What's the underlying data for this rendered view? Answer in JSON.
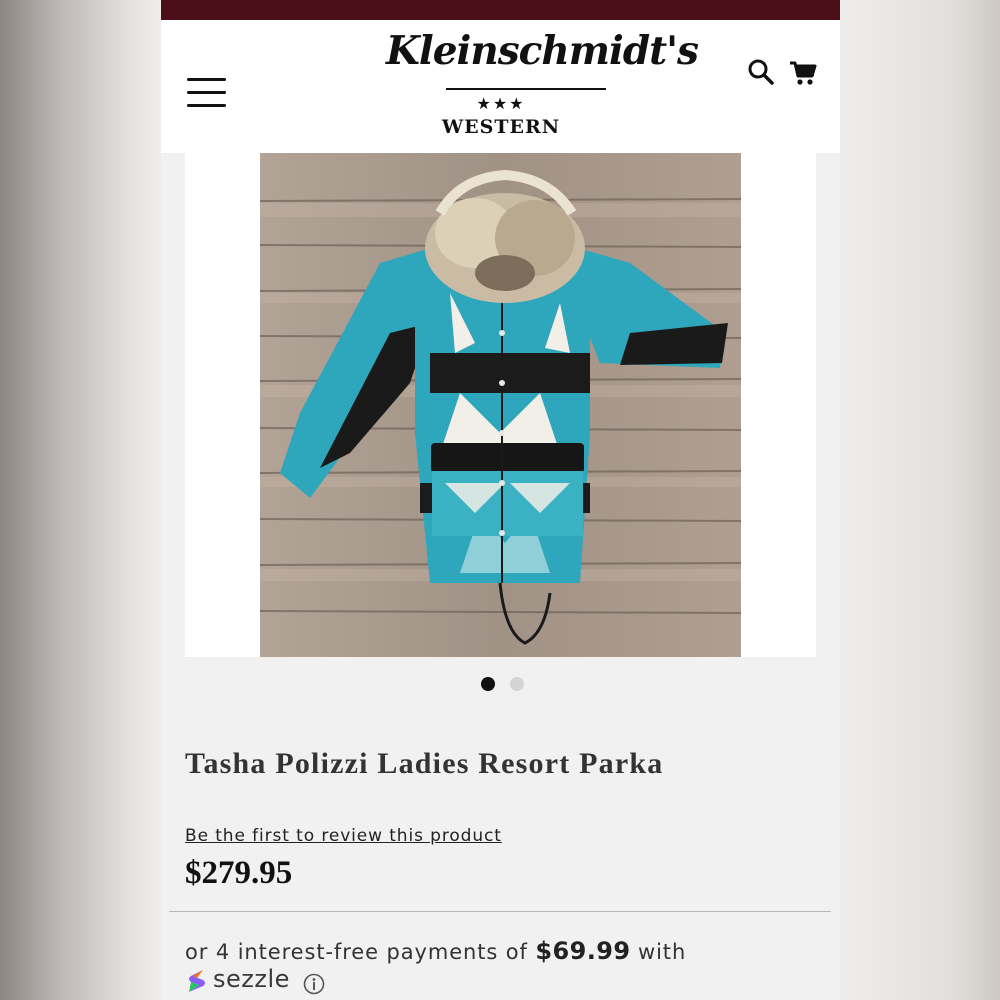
{
  "colors": {
    "topbar": "#4b0f1a",
    "header_bg": "#ffffff",
    "page_bg": "#f1f1f1",
    "text_primary": "#111111",
    "text_secondary": "#333333",
    "dot_active": "#111111",
    "dot_inactive": "#d4d4d4",
    "jacket_turquoise": "#2ea6bb",
    "wood": "#a99a8d"
  },
  "header": {
    "menu_icon": "hamburger-menu-icon",
    "logo": {
      "script": "Kleinschmidt's",
      "stars": "★★★",
      "subtitle": "WESTERN"
    },
    "search_icon": "search-icon",
    "cart_icon": "shopping-cart-icon"
  },
  "gallery": {
    "image_alt": "Turquoise and black Aztec pattern parka with fur collar on wooden background",
    "total_images": 2,
    "active_index": 0
  },
  "product": {
    "title": "Tasha Polizzi Ladies Resort Parka",
    "review_link": "Be the first to review this product",
    "price": "$279.95"
  },
  "payment": {
    "prefix": "or 4 interest-free payments of ",
    "installment": "$69.99",
    "suffix": " with",
    "provider": "sezzle",
    "info_icon": "info-icon"
  }
}
